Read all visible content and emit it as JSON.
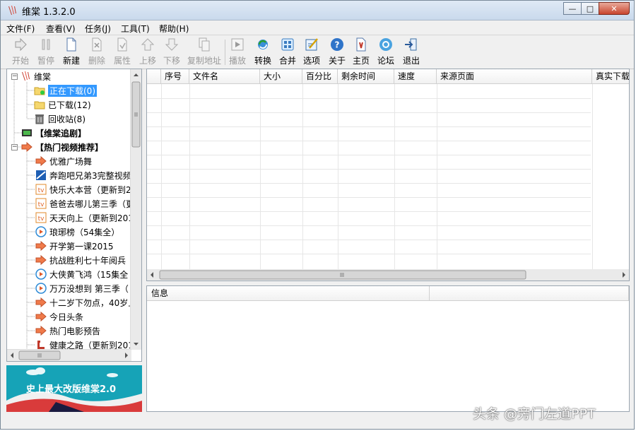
{
  "window": {
    "title": "维棠 1.3.2.0",
    "minimize": "—",
    "maximize": "□",
    "close": "✕"
  },
  "menu": [
    "文件(F)",
    "查看(V)",
    "任务(J)",
    "工具(T)",
    "帮助(H)"
  ],
  "toolbar": [
    {
      "label": "开始",
      "icon": "play-icon",
      "enabled": false
    },
    {
      "label": "暂停",
      "icon": "pause-icon",
      "enabled": false
    },
    {
      "label": "新建",
      "icon": "new-document-icon",
      "enabled": true
    },
    {
      "label": "删除",
      "icon": "delete-icon",
      "enabled": false
    },
    {
      "label": "属性",
      "icon": "properties-icon",
      "enabled": false
    },
    {
      "label": "上移",
      "icon": "move-up-icon",
      "enabled": false
    },
    {
      "label": "下移",
      "icon": "move-down-icon",
      "enabled": false
    },
    {
      "label": "复制地址",
      "icon": "copy-address-icon",
      "enabled": false
    },
    {
      "label": "播放",
      "icon": "playback-icon",
      "enabled": false
    },
    {
      "label": "转换",
      "icon": "convert-icon",
      "enabled": true
    },
    {
      "label": "合并",
      "icon": "merge-icon",
      "enabled": true
    },
    {
      "label": "选项",
      "icon": "options-icon",
      "enabled": true
    },
    {
      "label": "关于",
      "icon": "about-icon",
      "enabled": true
    },
    {
      "label": "主页",
      "icon": "homepage-icon",
      "enabled": true
    },
    {
      "label": "论坛",
      "icon": "forum-icon",
      "enabled": true
    },
    {
      "label": "退出",
      "icon": "exit-icon",
      "enabled": true
    }
  ],
  "tree": {
    "root": "维棠",
    "items": [
      {
        "label": "正在下载(0)",
        "icon": "downloading-folder-icon",
        "selected": true
      },
      {
        "label": "已下载(12)",
        "icon": "folder-icon"
      },
      {
        "label": "回收站(8)",
        "icon": "trash-icon"
      }
    ],
    "drama": "【维棠追剧】",
    "hot": "【热门视频推荐】",
    "hot_items": [
      {
        "label": "优雅广场舞",
        "icon": "arrow-right-icon"
      },
      {
        "label": "奔跑吧兄弟3完整视频",
        "icon": "video-site-icon"
      },
      {
        "label": "快乐大本营（更新到2",
        "icon": "tv-icon"
      },
      {
        "label": "爸爸去哪儿第三季（更",
        "icon": "tv-icon"
      },
      {
        "label": "天天向上（更新到201",
        "icon": "tv-icon"
      },
      {
        "label": "琅琊榜（54集全）",
        "icon": "play-circle-icon"
      },
      {
        "label": "开学第一课2015",
        "icon": "arrow-right-icon"
      },
      {
        "label": "抗战胜利七十年阅兵",
        "icon": "arrow-right-icon"
      },
      {
        "label": "大侠黄飞鸿（15集全",
        "icon": "play-circle-icon"
      },
      {
        "label": "万万没想到 第三季（",
        "icon": "play-circle-icon"
      },
      {
        "label": "十二岁下勿点，40岁上",
        "icon": "arrow-right-icon"
      },
      {
        "label": "今日头条",
        "icon": "arrow-right-icon"
      },
      {
        "label": "热门电影预告",
        "icon": "arrow-right-icon"
      },
      {
        "label": "健康之路（更新到201",
        "icon": "channel-icon"
      }
    ]
  },
  "banner": {
    "text": "史上最大改版维棠2.0"
  },
  "columns": [
    "序号",
    "文件名",
    "大小",
    "百分比",
    "剩余时间",
    "速度",
    "来源页面",
    "真实下载"
  ],
  "info": {
    "header": "信息"
  },
  "watermark": "头条 @旁门左道PPT",
  "colors": {
    "accent": "#3399ff",
    "banner": "#16a3b7"
  }
}
